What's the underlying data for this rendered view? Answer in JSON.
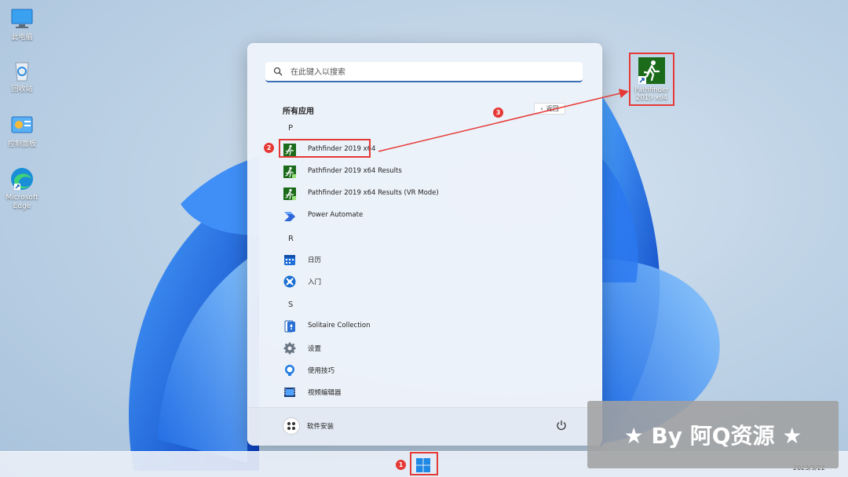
{
  "desktop": {
    "icons": [
      {
        "label": "此电脑",
        "icon": "computer-icon"
      },
      {
        "label": "回收站",
        "icon": "recycle-bin-icon"
      },
      {
        "label": "控制面板",
        "icon": "control-panel-icon"
      },
      {
        "label": "Microsoft Edge",
        "icon": "edge-icon"
      }
    ],
    "target_icon": {
      "label": "Pathfinder 2019 x64",
      "icon": "pathfinder-icon"
    }
  },
  "start_menu": {
    "search": {
      "placeholder": "在此键入以搜索"
    },
    "section_title": "所有应用",
    "back_label": "返回",
    "groups": [
      {
        "letter": "P",
        "apps": [
          {
            "label": "Pathfinder 2019 x64",
            "icon": "pathfinder-icon"
          },
          {
            "label": "Pathfinder 2019 x64 Results",
            "icon": "pathfinder-results-icon"
          },
          {
            "label": "Pathfinder 2019 x64 Results (VR Mode)",
            "icon": "pathfinder-vr-icon"
          },
          {
            "label": "Power Automate",
            "icon": "power-automate-icon"
          }
        ]
      },
      {
        "letter": "R",
        "apps": [
          {
            "label": "日历",
            "icon": "calendar-icon"
          },
          {
            "label": "入门",
            "icon": "tips-start-icon"
          }
        ]
      },
      {
        "letter": "S",
        "apps": [
          {
            "label": "Solitaire Collection",
            "icon": "solitaire-icon"
          },
          {
            "label": "设置",
            "icon": "settings-gear-icon"
          },
          {
            "label": "使用技巧",
            "icon": "lightbulb-icon"
          },
          {
            "label": "视频编辑器",
            "icon": "video-editor-icon"
          }
        ]
      }
    ],
    "footer": {
      "user_label": "软件安装",
      "power_icon": "power-icon"
    }
  },
  "annotations": {
    "badge1": "1",
    "badge2": "2",
    "badge3": "3",
    "color": "#e53935"
  },
  "taskbar": {
    "clock_date": "2023/3/22",
    "start_icon": "windows-logo-icon"
  },
  "watermark": "★ By 阿Q资源 ★",
  "colors": {
    "accent": "#3a6fb7",
    "pathfinder_green": "#1b6b1b"
  }
}
